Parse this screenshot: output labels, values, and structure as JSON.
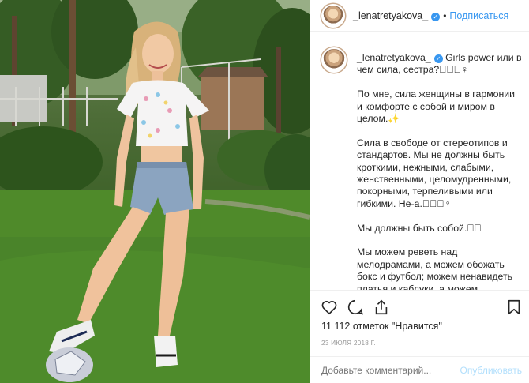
{
  "header": {
    "username": "_lenatretyakova_",
    "separator": "•",
    "follow_label": "Подписаться"
  },
  "caption": {
    "username": "_lenatretyakova_",
    "paragraphs": [
      "Girls power или в чем сила, сестра?🏻🏻🏻♀",
      "По мне, сила женщины в гармонии и комфорте с собой и миром в целом.✨",
      "Сила в свободе от стереотипов и стандартов. Мы не должны быть кроткими, нежными, слабыми, женственными, целомудренными, покорными, терпеливыми или гибкими. Не-а.🏻🏻🏻♀",
      "Мы должны быть собой.🏻🏻",
      "Мы можем реветь над мелодрамами, а можем обожать бокс и футбол; можем ненавидеть платья и каблуки, а можем"
    ]
  },
  "actions": {
    "like_icon": "heart-icon",
    "comment_icon": "comment-icon",
    "share_icon": "share-icon",
    "save_icon": "bookmark-icon"
  },
  "likes_text": "11 112 отметок \"Нравится\"",
  "date_text": "23 ИЮЛЯ 2018 Г.",
  "comment": {
    "placeholder": "Добавьте комментарий...",
    "publish_label": "Опубликовать"
  },
  "colors": {
    "link": "#3897f0",
    "publish_disabled": "#b2dffc",
    "muted": "#999999",
    "text": "#262626"
  }
}
